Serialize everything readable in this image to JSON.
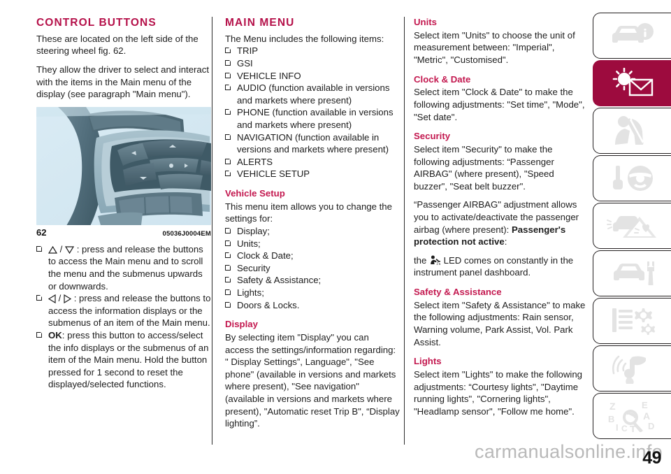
{
  "page": {
    "number": "49",
    "watermark": "carmanualsonline.info"
  },
  "colors": {
    "heading": "#b5114a",
    "subheading": "#c3184f",
    "active_tab": "#9d0b3e",
    "body_text": "#1d1d1d"
  },
  "column1": {
    "title": "CONTROL BUTTONS",
    "p1": "These are located on the left side of the steering wheel fig. 62.",
    "p2": "They allow the driver to select and interact with the items in the Main menu of the display (see paragraph \"Main menu\").",
    "figure": {
      "number": "62",
      "code": "05036J0004EM",
      "alt": "steering wheel control buttons"
    },
    "bullets": [
      {
        "icons": [
          "triangle-up",
          "triangle-down"
        ],
        "separator": "/",
        "text": ": press and release the buttons to access the Main menu and to scroll the menu and the submenus upwards or downwards."
      },
      {
        "icons": [
          "triangle-left",
          "triangle-right"
        ],
        "separator": "/",
        "text": ": press and release the buttons to access the information displays or the submenus of an item of the Main menu."
      },
      {
        "bold": "OK",
        "text": ": press this button to access/select the info displays or the submenus of an item of the Main menu. Hold the button pressed for 1 second to reset the displayed/selected functions."
      }
    ]
  },
  "column2": {
    "title": "MAIN MENU",
    "intro": "The Menu includes the following items:",
    "menu_items": [
      "TRIP",
      "GSI",
      "VEHICLE INFO",
      "AUDIO (function available in versions and markets where present)",
      "PHONE (function available in versions and markets where present)",
      "NAVIGATION (function available in versions and markets where present)",
      "ALERTS",
      "VEHICLE SETUP"
    ],
    "vehicle_setup": {
      "heading": "Vehicle Setup",
      "intro": "This menu item allows you to change the settings for:",
      "items": [
        "Display;",
        "Units;",
        "Clock & Date;",
        "Security",
        "Safety & Assistance;",
        "Lights;",
        "Doors & Locks."
      ]
    },
    "display": {
      "heading": "Display",
      "text": "By selecting item \"Display\" you can access the settings/information regarding: \" Display Settings”, Language\", \"See phone\" (available in versions and markets where present), \"See navigation\" (available in versions and markets where present), \"Automatic reset Trip B\", “Display lighting”."
    }
  },
  "column3": {
    "units": {
      "heading": "Units",
      "text": "Select item \"Units\" to choose the unit of measurement between: \"Imperial\", \"Metric\", \"Customised\"."
    },
    "clock_date": {
      "heading": "Clock & Date",
      "text": "Select item \"Clock & Date\" to make the following adjustments: \"Set time\", \"Mode\", \"Set date\"."
    },
    "security": {
      "heading": "Security",
      "text1": "Select item \"Security\" to make the following adjustments: “Passenger AIRBAG\" (where present), \"Speed buzzer\", \"Seat belt buzzer\".",
      "text2_a": "“Passenger AIRBAG\" adjustment allows you to activate/deactivate the passenger airbag (where present): ",
      "text2_bold": "Passenger's protection not active",
      "text2_b": ":",
      "text3_a": "the ",
      "text3_b": " LED comes on constantly in the instrument panel dashboard."
    },
    "safety_assistance": {
      "heading": "Safety & Assistance",
      "text": "Select item \"Safety & Assistance\" to make the following adjustments: Rain sensor, Warning volume, Park Assist, Vol. Park Assist."
    },
    "lights": {
      "heading": "Lights",
      "text": "Select item \"Lights\" to make the following adjustments: “Courtesy lights\", \"Daytime running lights\", \"Cornering lights\", \"Headlamp sensor\", \"Follow me home\"."
    }
  },
  "side_tabs": [
    {
      "name": "vehicle-info",
      "icon": "car-info-icon",
      "active": false
    },
    {
      "name": "dashboard-warning-lights-messages",
      "icon": "sun-envelope-icon",
      "active": true
    },
    {
      "name": "safety",
      "icon": "seatbelt-passenger-icon",
      "active": false
    },
    {
      "name": "starting-and-driving",
      "icon": "key-steering-wheel-icon",
      "active": false
    },
    {
      "name": "emergency",
      "icon": "car-warning-triangle-icon",
      "active": false
    },
    {
      "name": "maintenance-and-care",
      "icon": "car-wrench-icon",
      "active": false
    },
    {
      "name": "technical-specifications",
      "icon": "list-gears-icon",
      "active": false
    },
    {
      "name": "multimedia",
      "icon": "music-signal-icon",
      "active": false
    },
    {
      "name": "alphabetical-index",
      "icon": "letters-magnifier-icon",
      "active": false
    }
  ]
}
